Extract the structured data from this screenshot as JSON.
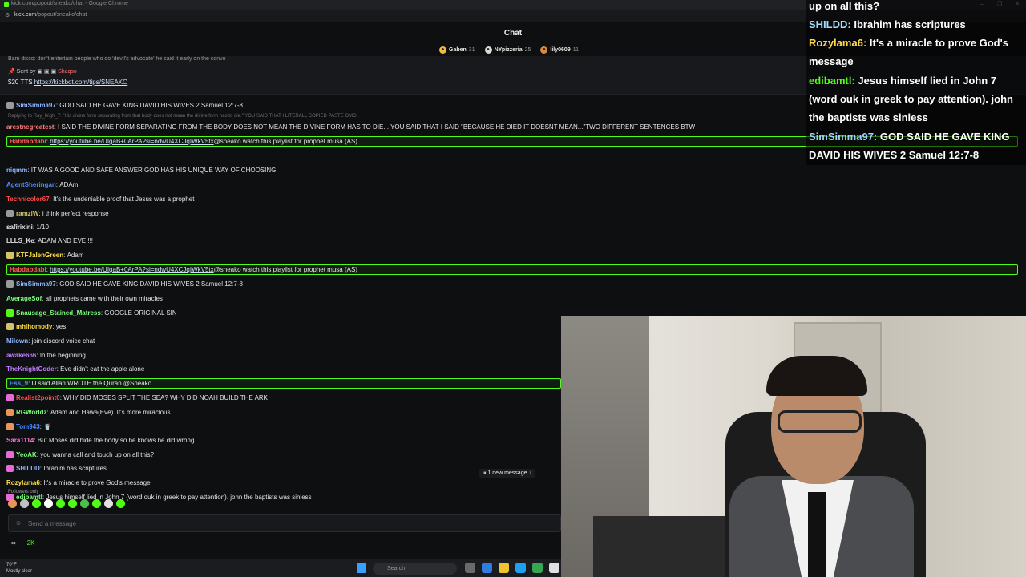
{
  "browser": {
    "title": "kick.com/popout/sneako/chat - Google Chrome",
    "url_host": "kick.com",
    "url_path": "/popout/sneako/chat",
    "window_controls": [
      "–",
      "❐",
      "✕"
    ]
  },
  "chat": {
    "title": "Chat",
    "top_gifters": [
      {
        "name": "Gaben",
        "count": "31",
        "color": "#f5b942"
      },
      {
        "name": "NYpizzeria",
        "count": "25",
        "color": "#d9d9d9"
      },
      {
        "name": "lily0609",
        "count": "11",
        "color": "#d98a3a"
      }
    ],
    "pinned": {
      "cut_line": "Bam disco: don't entertain people who do 'devil's advocate' he said it early on the convo",
      "sent_by_label": "Sent by",
      "sent_by_user": "Shaqso",
      "tts_text": "$20 TTS",
      "tts_link": "https://kickbot.com/tips/SNEAKO"
    },
    "messages": [
      {
        "user": "SimSimma97",
        "text": "GOD SAID HE GAVE KING DAVID HIS WIVES 2 Samuel 12:7-8",
        "color": "#8fb7ff",
        "badge": "#9a9a9a"
      },
      {
        "reply": "Replying to Ray_leigh_7: \"His divine form separating from that body does not mean the divine form has to die.\" YOU SAID THAT I LITERALL COPIED PASTE OMG",
        "user": "arestnegreatest",
        "text": "I SAID THE DIVINE FORM SEPARATING FROM THE BODY DOES NOT MEAN THE DIVINE FORM HAS TO DIE... YOU SAID THAT I SAID \"BECAUSE HE DIED IT DOESNT MEAN...\"TWO DIFFERENT SENTENCES BTW",
        "color": "#ff7b7b"
      },
      {
        "user": "Habdabdabi",
        "text": "https://youtube.be/UIgaB+0ArPA?si=ndwU4XCJqIWkV5tx @sneako watch this playlist for prophet musa (AS)",
        "color": "#ff5c5c",
        "highlight": true
      },
      {
        "user": "",
        "text": "IT WAS A GOOD AND SAFE ANSWER GOD HAS HIS UNIQUE WAY OF CHOOSING",
        "color": "#cfcfcf"
      },
      {
        "user": "niqmm",
        "text": "IT WAS A GOOD AND SAFE ANSWER GOD HAS HIS UNIQUE WAY OF CHOOSING",
        "color": "#8fb7ff"
      },
      {
        "user": "AgentSheringan",
        "text": "ADAm",
        "color": "#4b8cff"
      },
      {
        "user": "Technicolor67",
        "text": "It's the undeniable proof that Jesus was a prophet",
        "color": "#ff4b4b"
      },
      {
        "user": "ramziW",
        "text": "i think perfect response",
        "color": "#d4c36a",
        "badge": "#9a9a9a"
      },
      {
        "user": "safirixini",
        "text": "1/10",
        "color": "#e6e6e6"
      },
      {
        "user": "LLLS_Ke",
        "text": "ADAM AND EVE !!!",
        "color": "#e6e6e6"
      },
      {
        "user": "KTFJalenGreen",
        "text": "Adam",
        "color": "#ffe44b",
        "badge": "#d4c36a"
      },
      {
        "user": "Habdabdabi",
        "text": "https://youtube.be/UIgaB+0ArPA?si=ndwU4XCJqIWkV5tx @sneako watch this playlist for prophet musa (AS)",
        "color": "#ff5c5c",
        "highlight": true
      },
      {
        "user": "SimSimma97",
        "text": "GOD SAID HE GAVE KING DAVID HIS WIVES 2 Samuel 12:7-8",
        "color": "#8fb7ff",
        "badge": "#9a9a9a"
      },
      {
        "user": "AverageSof",
        "text": "all prophets came with their own miracles",
        "color": "#7bff7b"
      },
      {
        "user": "Snausage_Stained_Matress",
        "text": "GOOGLE ORIGINAL SIN",
        "color": "#7bff7b",
        "badge": "#53fc18"
      },
      {
        "user": "mhlhomody",
        "text": "yes",
        "color": "#ffe44b",
        "badge": "#d4c36a"
      },
      {
        "user": "Milown",
        "text": "join discord voice chat",
        "color": "#8fb7ff"
      },
      {
        "user": "awake666",
        "text": "In the beginning",
        "color": "#c07bff"
      },
      {
        "user": "TheKnightCoder",
        "text": "Eve didn't eat the apple alone",
        "color": "#c07bff"
      },
      {
        "user": "Ess_9",
        "text": "U said Allah WROTE the Quran @Sneako",
        "color": "#4b8cff",
        "highlight": true
      },
      {
        "user": "Realist2point0",
        "text": "WHY DID MOSES SPLIT THE SEA? WHY DID NOAH BUILD THE ARK",
        "color": "#ff4b4b",
        "badge": "#e86ad6"
      },
      {
        "user": "RGWorldz",
        "text": "Adam and Hawa(Eve). It's more miraclous.",
        "color": "#7bff7b",
        "badge": "#e8955a"
      },
      {
        "user": "Tom943",
        "text": "🥤",
        "color": "#4b8cff",
        "badge": "#e8955a"
      },
      {
        "user": "Sara1114",
        "text": "But Moses did hide the body so he knows he did wrong",
        "color": "#ff7bd4"
      },
      {
        "user": "YeoAK",
        "text": "you wanna call and touch up on all this?",
        "color": "#7bff7b",
        "badge": "#e86ad6"
      },
      {
        "user": "SHILDD",
        "text": "Ibrahim has scriptures",
        "color": "#8fb7ff",
        "badge": "#e86ad6"
      },
      {
        "user": "Rozylama6",
        "text": "It's a miracle to prove God's message",
        "color": "#ffe44b"
      },
      {
        "user": "edibamtl",
        "text": "Jesus himself lied in John 7 (word ouk in greek to pay attention). john the baptists was sinless",
        "color": "#7bff7b",
        "badge": "#e86ad6"
      }
    ],
    "new_message_label": "1 new message ↓",
    "followers_only": "Followers only",
    "send_placeholder": "Send a message",
    "footer": {
      "infinity": "∞",
      "count": "2K"
    }
  },
  "overlay": [
    {
      "user": "",
      "text": "up on all this?"
    },
    {
      "user": "SHILDD:",
      "text": "Ibrahim has scriptures",
      "color": "#a0e0ff"
    },
    {
      "user": "Rozylama6:",
      "text": "It's a miracle to prove God's message",
      "color": "#ffd84a"
    },
    {
      "user": "edibamtl:",
      "text": "Jesus himself lied in John 7 (word ouk in greek to pay attention). john the baptists was sinless",
      "color": "#53fc18"
    },
    {
      "user": "SimSimma97:",
      "text": "GOD SAID HE GAVE KING DAVID HIS WIVES 2 Samuel 12:7-8",
      "color": "#a0d0ff"
    }
  ],
  "taskbar": {
    "weather_temp": "70°F",
    "weather_desc": "Mostly clear",
    "search_label": "Search"
  }
}
